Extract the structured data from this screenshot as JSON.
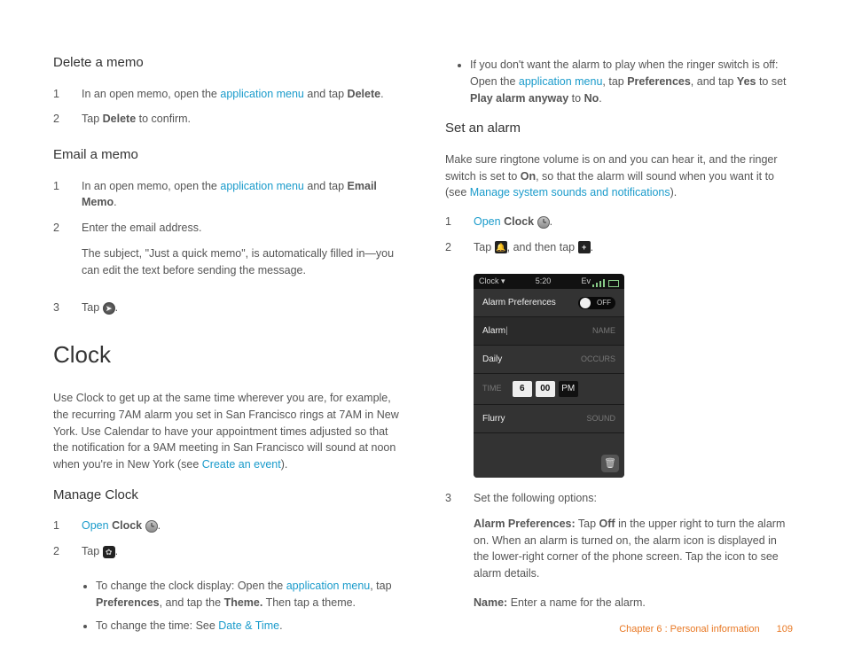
{
  "left": {
    "delete_memo": {
      "heading": "Delete a memo",
      "step1_prefix": "In an open memo, open the ",
      "app_menu": "application menu",
      "step1_mid": " and tap ",
      "delete": "Delete",
      "step1_end": ".",
      "step2_prefix": "Tap ",
      "step2_end": " to confirm."
    },
    "email_memo": {
      "heading": "Email a memo",
      "step1_prefix": "In an open memo, open the ",
      "step1_mid": " and tap ",
      "email_memo": "Email Memo",
      "step1_end": ".",
      "step2": "Enter the email address.",
      "step2_detail": "The subject, \"Just a quick memo\", is automatically filled in—you can edit the text before sending the message.",
      "step3": "Tap "
    },
    "clock_section": {
      "title": "Clock",
      "intro_prefix": "Use Clock to get up at the same time wherever you are, for example, the recurring 7AM alarm you set in San Francisco rings at 7AM in New York. Use Calendar to have your appointment times adjusted so that the notification for a 9AM meeting in San Francisco will sound at noon when you're in New York (see ",
      "create_event": "Create an event",
      "intro_end": ")."
    },
    "manage_clock": {
      "heading": "Manage Clock",
      "open": "Open",
      "clock": "Clock",
      "step2": "Tap ",
      "bullet1_prefix": "To change the clock display: Open the ",
      "bullet1_mid": ", tap ",
      "preferences": "Preferences",
      "bullet1_mid2": ", and tap the ",
      "theme": "Theme.",
      "bullet1_end": " Then tap a theme.",
      "bullet2_prefix": "To change the time: See ",
      "date_time": "Date & Time",
      "bullet2_end": "."
    }
  },
  "right": {
    "ringer_bullet": {
      "line1": "If you don't want the alarm to play when the ringer switch is off: Open the ",
      "app_menu": "application menu",
      "line2": ", tap ",
      "preferences": "Preferences",
      "line3": ", and tap ",
      "yes": "Yes",
      "line4": " to set ",
      "play_anyway": "Play alarm anyway",
      "line5": " to ",
      "no": "No",
      "line6": "."
    },
    "set_alarm": {
      "heading": "Set an alarm",
      "intro_prefix": "Make sure ringtone volume is on and you can hear it, and the ringer switch is set to ",
      "on": "On",
      "intro_mid": ", so that the alarm will sound when you want it to (see ",
      "manage_sounds": "Manage system sounds and notifications",
      "intro_end": ").",
      "open": "Open",
      "clock": "Clock",
      "step2_a": "Tap ",
      "step2_b": ", and then tap ",
      "step3": "Set the following options:",
      "alarm_pref_label": "Alarm Preferences:",
      "alarm_pref_text": " Tap ",
      "off": "Off",
      "alarm_pref_rest": " in the upper right to turn the alarm on. When an alarm is turned on, the alarm icon is displayed in the lower-right corner of the phone screen. Tap the icon to see alarm details.",
      "name_label": "Name:",
      "name_text": " Enter a name for the alarm."
    }
  },
  "phone": {
    "app_name": "Clock",
    "time": "5:20",
    "net": "Ev",
    "pref_title": "Alarm Preferences",
    "toggle": "OFF",
    "alarm_name_placeholder": "Alarm",
    "name_label": "NAME",
    "daily": "Daily",
    "occurs": "OCCURS",
    "time_label": "TIME",
    "hour": "6",
    "min": "00",
    "ampm": "PM",
    "flurry": "Flurry",
    "sound": "SOUND"
  },
  "footer": {
    "chapter": "Chapter 6  :  Personal information",
    "page": "109"
  }
}
